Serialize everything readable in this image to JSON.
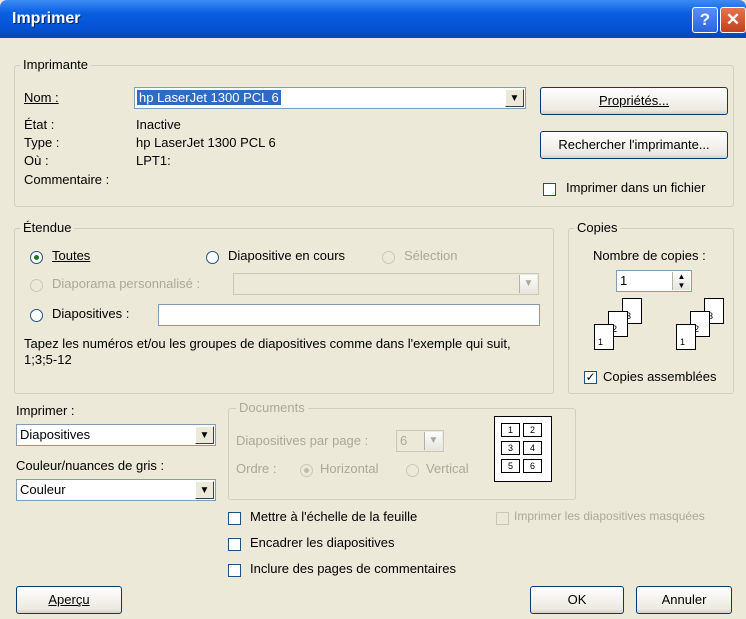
{
  "window": {
    "title": "Imprimer",
    "help_glyph": "?",
    "close_glyph": "✕"
  },
  "printer": {
    "legend": "Imprimante",
    "name_label": "Nom :",
    "name_value": "hp LaserJet 1300 PCL 6",
    "state_label": "État :",
    "state_value": "Inactive",
    "type_label": "Type :",
    "type_value": "hp LaserJet 1300 PCL 6",
    "where_label": "Où :",
    "where_value": "LPT1:",
    "comment_label": "Commentaire :",
    "properties_button": "Propriétés...",
    "find_button": "Rechercher l'imprimante...",
    "print_to_file_label": "Imprimer dans un fichier",
    "print_to_file_checked": false
  },
  "range": {
    "legend": "Étendue",
    "all_label": "Toutes",
    "current_label": "Diapositive en cours",
    "selection_label": "Sélection",
    "custom_show_label": "Diaporama personnalisé :",
    "slides_label": "Diapositives :",
    "slides_value": "",
    "hint": "Tapez les numéros et/ou les groupes de diapositives comme dans l'exemple qui suit, 1;3;5-12",
    "selected": "all"
  },
  "copies": {
    "legend": "Copies",
    "count_label": "Nombre de copies :",
    "count_value": "1",
    "collate_label": "Copies assemblées",
    "collate_checked": true,
    "page_numbers": [
      "1",
      "2",
      "3"
    ]
  },
  "print_what": {
    "label": "Imprimer :",
    "value": "Diapositives"
  },
  "color": {
    "label": "Couleur/nuances de gris :",
    "value": "Couleur"
  },
  "documents": {
    "legend": "Documents",
    "per_page_label": "Diapositives par page :",
    "per_page_value": "6",
    "order_label": "Ordre :",
    "horizontal_label": "Horizontal",
    "vertical_label": "Vertical",
    "preview_cells": [
      "1",
      "2",
      "3",
      "4",
      "5",
      "6"
    ]
  },
  "options": {
    "scale_label": "Mettre à l'échelle de la feuille",
    "frame_label": "Encadrer les diapositives",
    "comments_label": "Inclure des pages de commentaires",
    "hidden_label": "Imprimer les diapositives masquées"
  },
  "buttons": {
    "preview": "Aperçu",
    "ok": "OK",
    "cancel": "Annuler"
  }
}
